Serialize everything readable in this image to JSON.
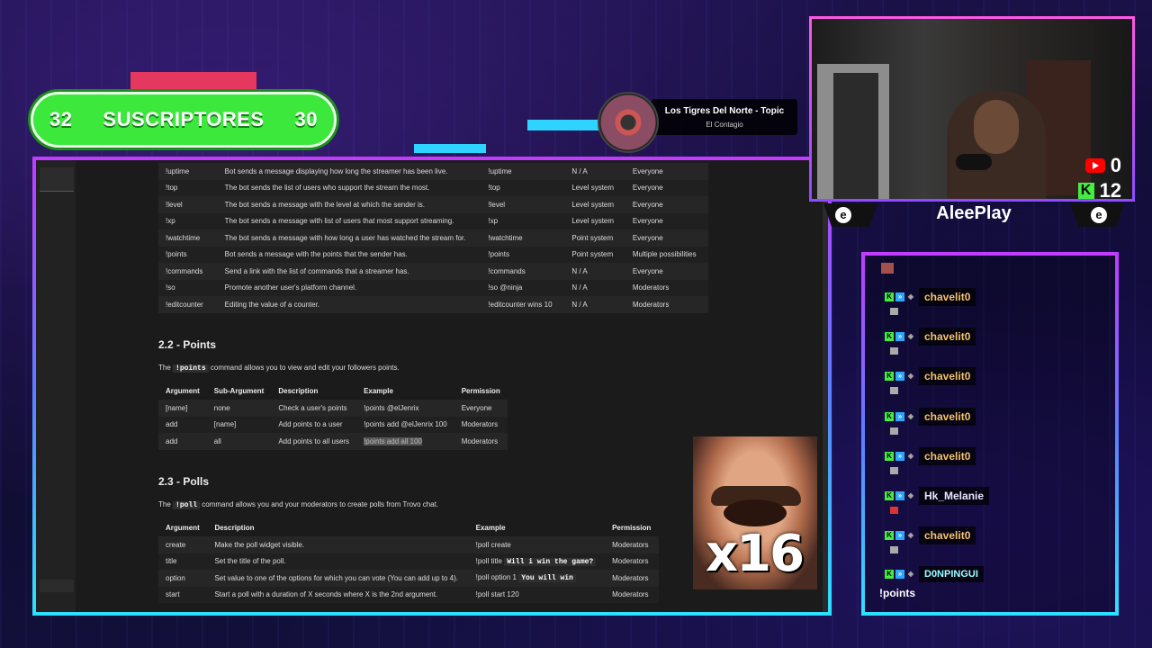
{
  "subs": {
    "left": "32",
    "label": "SUSCRIPTORES",
    "right": "30"
  },
  "music": {
    "title": "Los Tigres Del Norte - Topic",
    "subtitle": "El Contagio"
  },
  "commands_table": {
    "rows": [
      [
        "!uptime",
        "Bot sends a message displaying how long the streamer has been live.",
        "!uptime",
        "N / A",
        "Everyone"
      ],
      [
        "!top",
        "The bot sends the list of users who support the stream the most.",
        "!top",
        "Level system",
        "Everyone"
      ],
      [
        "!level",
        "The bot sends a message with the level at which the sender is.",
        "!level",
        "Level system",
        "Everyone"
      ],
      [
        "!xp",
        "The bot sends a message with list of users that most support streaming.",
        "!xp",
        "Level system",
        "Everyone"
      ],
      [
        "!watchtime",
        "The bot sends a message with how long a user has watched the stream for.",
        "!watchtime",
        "Point system",
        "Everyone"
      ],
      [
        "!points",
        "Bot sends a message with the points that the sender has.",
        "!points",
        "Point system",
        "Multiple possibilities"
      ],
      [
        "!commands",
        "Send a link with the list of commands that a streamer has.",
        "!commands",
        "N / A",
        "Everyone"
      ],
      [
        "!so",
        "Promote another user's platform channel.",
        "!so @ninja",
        "N / A",
        "Moderators"
      ],
      [
        "!editcounter",
        "Editing the value of a counter.",
        "!editcounter wins 10",
        "N / A",
        "Moderators"
      ]
    ]
  },
  "points_section": {
    "heading": "2.2 - Points",
    "intro_before": "The",
    "intro_code": "!points",
    "intro_after": "command allows you to view and edit your followers points.",
    "headers": [
      "Argument",
      "Sub-Argument",
      "Description",
      "Example",
      "Permission"
    ],
    "rows": [
      [
        "[name]",
        "none",
        "Check a user's points",
        "!points @elJenrix",
        "Everyone"
      ],
      [
        "add",
        "[name]",
        "Add points to a user",
        "!points add @elJenrix 100",
        "Moderators"
      ],
      [
        "add",
        "all",
        "Add points to all users",
        "!points add all 100",
        "Moderators"
      ]
    ]
  },
  "polls_section": {
    "heading": "2.3 - Polls",
    "intro_before": "The",
    "intro_code": "!poll",
    "intro_after": "command allows you and your moderators to create polls from Trovo chat.",
    "headers": [
      "Argument",
      "Description",
      "Example",
      "Permission"
    ],
    "rows": [
      {
        "arg": "create",
        "desc": "Make the poll widget visible.",
        "ex": "!poll create",
        "ex_code": "",
        "perm": "Moderators"
      },
      {
        "arg": "title",
        "desc": "Set the title of the poll.",
        "ex": "!poll title",
        "ex_code": "Will i win the game?",
        "perm": "Moderators"
      },
      {
        "arg": "option",
        "desc": "Set value to one of the options for which you can vote (You can add up to 4).",
        "ex": "!poll option 1",
        "ex_code": "You will win",
        "perm": "Moderators"
      },
      {
        "arg": "start",
        "desc": "Start a poll with a duration of X seconds where X is the 2nd argument.",
        "ex": "!poll start 120",
        "ex_code": "",
        "perm": "Moderators"
      }
    ]
  },
  "webcam": {
    "youtube_count": "0",
    "kick_count": "12"
  },
  "streamer": {
    "name": "AleePlay"
  },
  "chat": {
    "messages": [
      {
        "user": "chavelit0"
      },
      {
        "user": "chavelit0"
      },
      {
        "user": "chavelit0"
      },
      {
        "user": "chavelit0"
      },
      {
        "user": "chavelit0"
      },
      {
        "user": "Hk_Melanie"
      },
      {
        "user": "chavelit0"
      },
      {
        "user": "D0NPINGUI"
      }
    ],
    "last_message": "!points"
  },
  "meme": {
    "multiplier": "x16"
  },
  "colors": {
    "green": "#3be83b",
    "frame_top": "#c23bff",
    "frame_bottom": "#2ee0ff",
    "kick": "#43ee3f"
  }
}
